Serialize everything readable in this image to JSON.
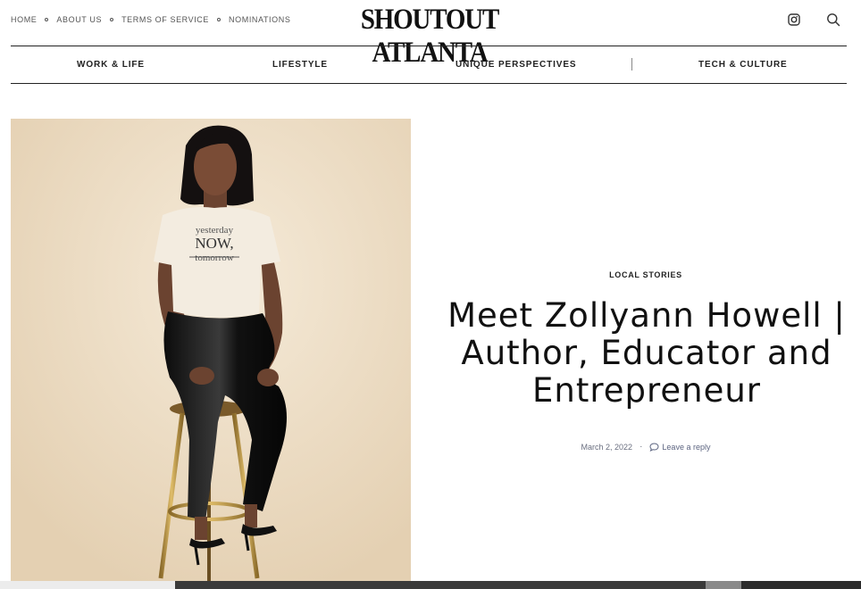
{
  "site": {
    "logo": "SHOUTOUT ATLANTA",
    "top_links": [
      "HOME",
      "ABOUT US",
      "TERMS OF SERVICE",
      "NOMINATIONS"
    ],
    "icons": [
      "instagram-icon",
      "search-icon"
    ]
  },
  "nav": {
    "items": [
      "WORK & LIFE",
      "LIFESTYLE",
      "UNIQUE PERSPECTIVES",
      "TECH & CULTURE"
    ]
  },
  "article": {
    "category": "LOCAL STORIES",
    "title": "Meet Zollyann Howell | Author, Educator and Entrepreneur",
    "date": "March 2, 2022",
    "reply_label": "Leave a reply",
    "shirt_text": [
      "yesterday",
      "NOW,",
      "tomorrow"
    ]
  },
  "colors": {
    "text": "#222222",
    "meta": "#6a6f80",
    "background": "#ffffff",
    "photo_backdrop": "#ecdcc2"
  }
}
